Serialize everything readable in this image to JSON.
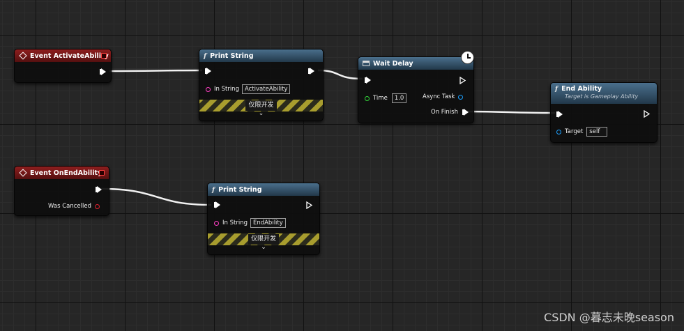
{
  "nodes": {
    "event_activate": {
      "title": "Event ActivateAbility"
    },
    "print_string_1": {
      "title": "Print String",
      "pin_label": "In String",
      "value": "ActivateAbility",
      "dev_label": "仅限开发",
      "expand": "⌄"
    },
    "wait_delay": {
      "title": "Wait Delay",
      "time_label": "Time",
      "time_value": "1.0",
      "async_label": "Async Task",
      "finish_label": "On Finish"
    },
    "end_ability": {
      "title": "End Ability",
      "subtitle": "Target is Gameplay Ability",
      "target_label": "Target",
      "target_value": "self"
    },
    "event_end": {
      "title": "Event OnEndAbility",
      "cancel_label": "Was Cancelled"
    },
    "print_string_2": {
      "title": "Print String",
      "pin_label": "In String",
      "value": "EndAbility",
      "dev_label": "仅限开发",
      "expand": "⌄"
    }
  },
  "icons": {
    "function": "f",
    "event": "event-diamond-icon",
    "latent": "clock-icon"
  },
  "colors": {
    "event_header": "#8e1e1e",
    "function_header": "#4a6f8c",
    "string_pin": "#ff3fc4",
    "float_pin": "#33d63a",
    "object_pin": "#1ca0ff",
    "bool_pin": "#e0202e"
  },
  "watermark": "CSDN @暮志未晚season"
}
